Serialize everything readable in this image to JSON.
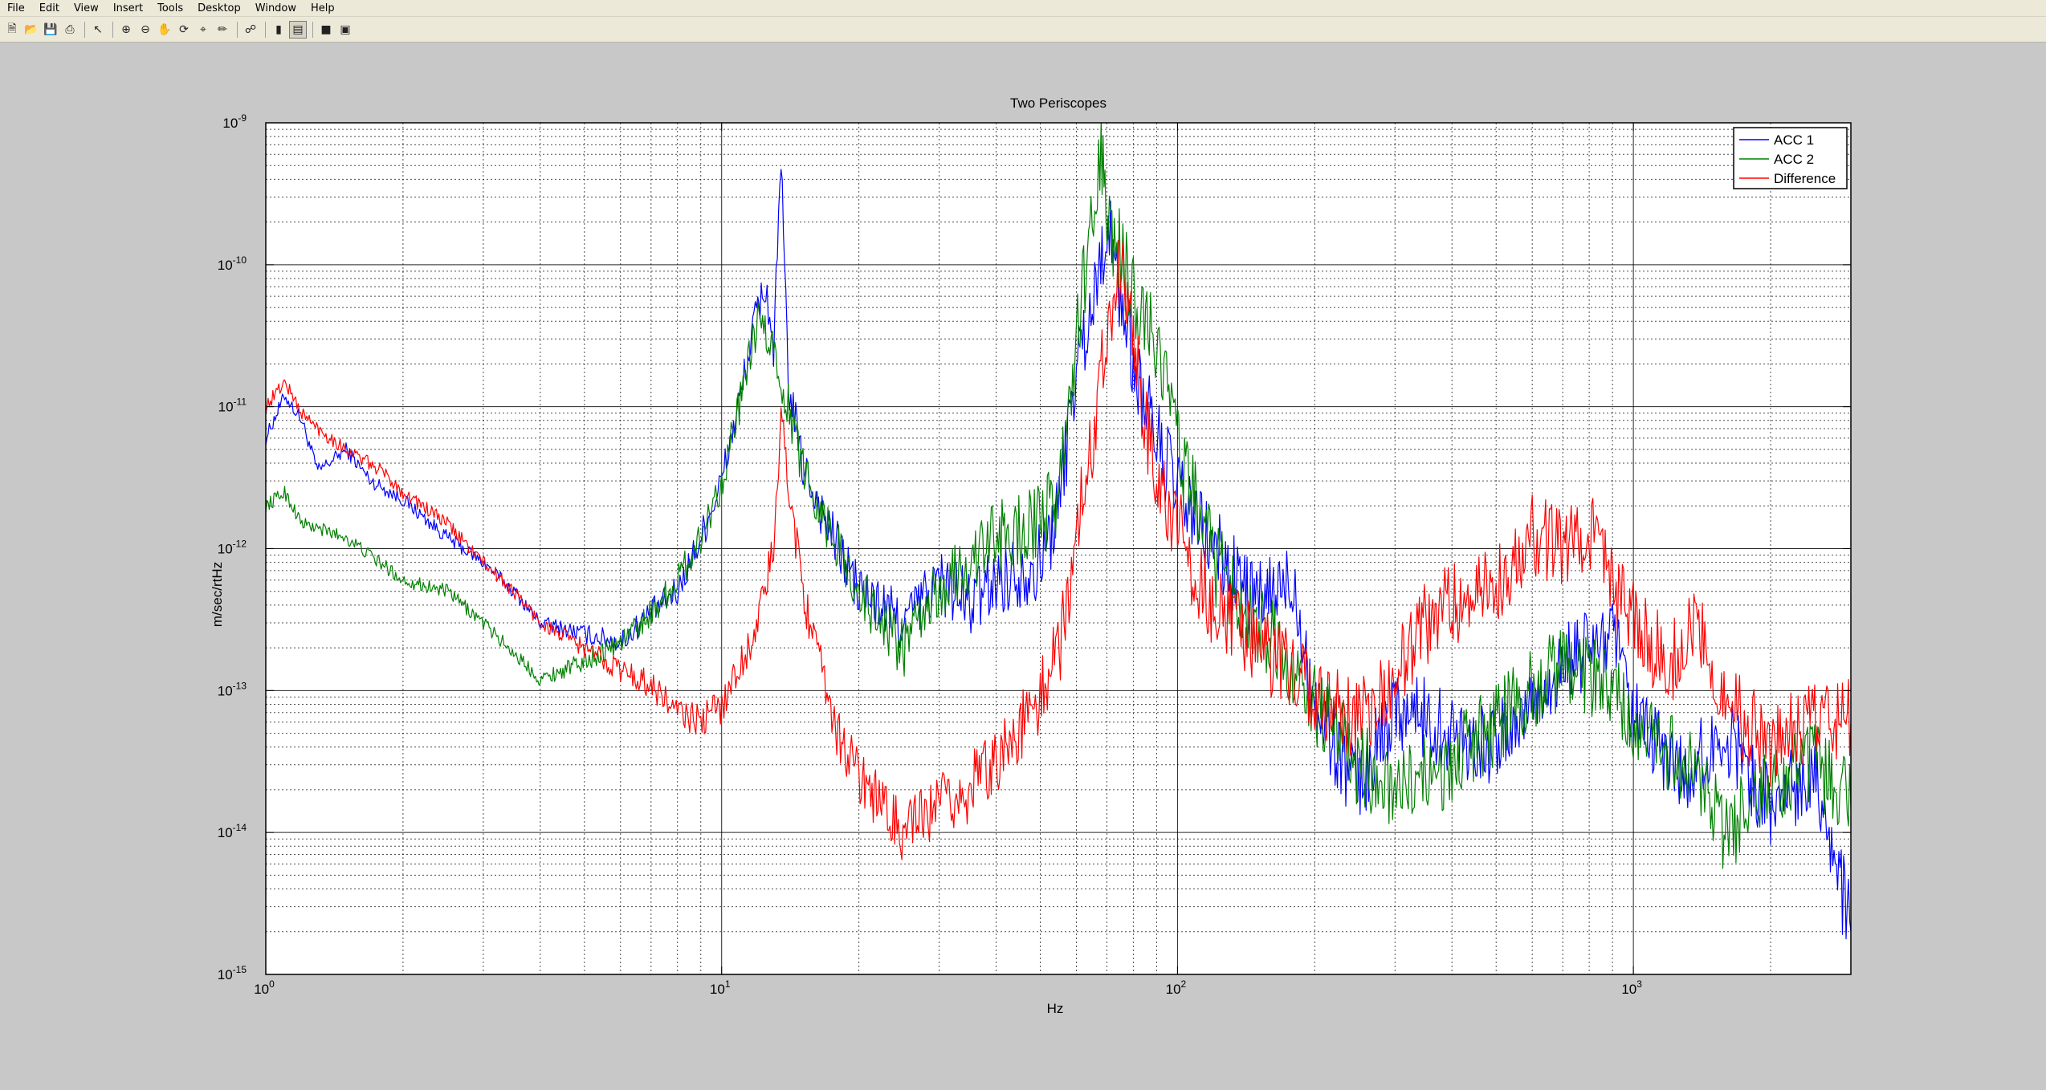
{
  "menu": [
    "File",
    "Edit",
    "View",
    "Insert",
    "Tools",
    "Desktop",
    "Window",
    "Help"
  ],
  "toolbar": {
    "icons": [
      "new-figure-icon",
      "open-file-icon",
      "save-icon",
      "print-icon",
      "edit-plot-icon",
      "zoom-in-icon",
      "zoom-out-icon",
      "pan-icon",
      "rotate-3d-icon",
      "data-cursor-icon",
      "brush-icon",
      "link-plot-icon",
      "insert-colorbar-icon",
      "insert-legend-icon",
      "hide-plot-tools-icon",
      "show-plot-tools-icon"
    ]
  },
  "chart_data": {
    "type": "line",
    "title": "Two Periscopes",
    "xlabel": "Hz",
    "ylabel": "m/sec/rtHz",
    "xscale": "log",
    "yscale": "log",
    "xlim": [
      1,
      3000
    ],
    "ylim": [
      1e-15,
      1e-09
    ],
    "grid": true,
    "legend_position": "top-right",
    "x_ticks": [
      {
        "value": 1,
        "base": "10",
        "exp": "0"
      },
      {
        "value": 10,
        "base": "10",
        "exp": "1"
      },
      {
        "value": 100,
        "base": "10",
        "exp": "2"
      },
      {
        "value": 1000,
        "base": "10",
        "exp": "3"
      }
    ],
    "y_ticks": [
      {
        "value": 1e-09,
        "base": "10",
        "exp": "-9"
      },
      {
        "value": 1e-10,
        "base": "10",
        "exp": "-10"
      },
      {
        "value": 1e-11,
        "base": "10",
        "exp": "-11"
      },
      {
        "value": 1e-12,
        "base": "10",
        "exp": "-12"
      },
      {
        "value": 1e-13,
        "base": "10",
        "exp": "-13"
      },
      {
        "value": 1e-14,
        "base": "10",
        "exp": "-14"
      },
      {
        "value": 1e-15,
        "base": "10",
        "exp": "-15"
      }
    ],
    "series": [
      {
        "name": "ACC 1",
        "color": "#0000ff",
        "points": [
          [
            1.0,
            6e-12
          ],
          [
            1.1,
            1.2e-11
          ],
          [
            1.2,
            8e-12
          ],
          [
            1.3,
            3.5e-12
          ],
          [
            1.5,
            5e-12
          ],
          [
            1.7,
            3e-12
          ],
          [
            2.0,
            2.2e-12
          ],
          [
            2.5,
            1.2e-12
          ],
          [
            3.0,
            8e-13
          ],
          [
            3.5,
            5e-13
          ],
          [
            4.0,
            3e-13
          ],
          [
            5.0,
            2.5e-13
          ],
          [
            6.0,
            2.2e-13
          ],
          [
            7.0,
            3.5e-13
          ],
          [
            8.0,
            5e-13
          ],
          [
            9.0,
            1.2e-12
          ],
          [
            10.0,
            3e-12
          ],
          [
            11.0,
            1.2e-11
          ],
          [
            12.0,
            5e-11
          ],
          [
            12.5,
            7e-11
          ],
          [
            13.0,
            2.5e-11
          ],
          [
            13.5,
            5e-10
          ],
          [
            14.0,
            1.5e-11
          ],
          [
            15.0,
            4e-12
          ],
          [
            17.0,
            1.5e-12
          ],
          [
            20.0,
            5e-13
          ],
          [
            25.0,
            3e-13
          ],
          [
            30.0,
            6e-13
          ],
          [
            35.0,
            4e-13
          ],
          [
            40.0,
            6e-13
          ],
          [
            50.0,
            8e-13
          ],
          [
            55.0,
            2e-12
          ],
          [
            60.0,
            2e-11
          ],
          [
            65.0,
            5e-11
          ],
          [
            70.0,
            2e-10
          ],
          [
            75.0,
            6e-11
          ],
          [
            80.0,
            2e-11
          ],
          [
            90.0,
            6e-12
          ],
          [
            100.0,
            2.5e-12
          ],
          [
            120.0,
            1e-12
          ],
          [
            150.0,
            4e-13
          ],
          [
            180.0,
            6e-13
          ],
          [
            200.0,
            8e-14
          ],
          [
            250.0,
            2e-14
          ],
          [
            300.0,
            8e-14
          ],
          [
            400.0,
            5e-14
          ],
          [
            500.0,
            4e-14
          ],
          [
            700.0,
            1.5e-13
          ],
          [
            900.0,
            2.5e-13
          ],
          [
            1000.0,
            6e-14
          ],
          [
            1300.0,
            2.5e-14
          ],
          [
            1600.0,
            5e-14
          ],
          [
            2000.0,
            1.5e-14
          ],
          [
            2500.0,
            3e-14
          ],
          [
            3000.0,
            2e-15
          ]
        ]
      },
      {
        "name": "ACC 2",
        "color": "#008000",
        "points": [
          [
            1.0,
            2e-12
          ],
          [
            1.1,
            2.5e-12
          ],
          [
            1.2,
            1.5e-12
          ],
          [
            1.5,
            1.2e-12
          ],
          [
            2.0,
            6e-13
          ],
          [
            2.5,
            5e-13
          ],
          [
            3.0,
            3e-13
          ],
          [
            4.0,
            1.2e-13
          ],
          [
            5.0,
            1.6e-13
          ],
          [
            6.0,
            2.2e-13
          ],
          [
            7.0,
            3.5e-13
          ],
          [
            8.0,
            6e-13
          ],
          [
            9.0,
            1.2e-12
          ],
          [
            10.0,
            3e-12
          ],
          [
            11.0,
            1.1e-11
          ],
          [
            12.0,
            4e-11
          ],
          [
            13.0,
            2.5e-11
          ],
          [
            14.0,
            1e-11
          ],
          [
            15.0,
            4e-12
          ],
          [
            17.0,
            1.5e-12
          ],
          [
            20.0,
            5e-13
          ],
          [
            25.0,
            2e-13
          ],
          [
            30.0,
            5e-13
          ],
          [
            40.0,
            1.2e-12
          ],
          [
            50.0,
            1.5e-12
          ],
          [
            55.0,
            2.5e-12
          ],
          [
            60.0,
            3e-11
          ],
          [
            65.0,
            2e-10
          ],
          [
            68.0,
            6e-10
          ],
          [
            70.0,
            2e-10
          ],
          [
            75.0,
            1.2e-10
          ],
          [
            80.0,
            6e-11
          ],
          [
            90.0,
            3e-11
          ],
          [
            100.0,
            6e-12
          ],
          [
            110.0,
            2e-12
          ],
          [
            120.0,
            8e-13
          ],
          [
            150.0,
            3e-13
          ],
          [
            200.0,
            8e-14
          ],
          [
            250.0,
            3e-14
          ],
          [
            300.0,
            2e-14
          ],
          [
            400.0,
            3e-14
          ],
          [
            500.0,
            6e-14
          ],
          [
            700.0,
            1.5e-13
          ],
          [
            900.0,
            1e-13
          ],
          [
            1000.0,
            5e-14
          ],
          [
            1300.0,
            3e-14
          ],
          [
            1600.0,
            1e-14
          ],
          [
            2000.0,
            2e-14
          ],
          [
            2500.0,
            3e-14
          ],
          [
            3000.0,
            1.5e-14
          ]
        ]
      },
      {
        "name": "Difference",
        "color": "#ff0000",
        "points": [
          [
            1.0,
            1e-11
          ],
          [
            1.1,
            1.5e-11
          ],
          [
            1.2,
            9e-12
          ],
          [
            1.3,
            7e-12
          ],
          [
            1.5,
            5e-12
          ],
          [
            1.8,
            3.5e-12
          ],
          [
            2.0,
            2.5e-12
          ],
          [
            2.5,
            1.5e-12
          ],
          [
            3.0,
            8e-13
          ],
          [
            3.5,
            5e-13
          ],
          [
            4.0,
            3e-13
          ],
          [
            5.0,
            2e-13
          ],
          [
            6.0,
            1.4e-13
          ],
          [
            7.0,
            1.1e-13
          ],
          [
            8.0,
            7e-14
          ],
          [
            9.0,
            6e-14
          ],
          [
            10.0,
            8e-14
          ],
          [
            11.0,
            1.5e-13
          ],
          [
            12.0,
            3e-13
          ],
          [
            13.0,
            1e-12
          ],
          [
            13.5,
            8e-12
          ],
          [
            14.0,
            3e-12
          ],
          [
            15.0,
            6e-13
          ],
          [
            16.0,
            2e-13
          ],
          [
            18.0,
            5e-14
          ],
          [
            20.0,
            2.5e-14
          ],
          [
            25.0,
            1e-14
          ],
          [
            30.0,
            1.5e-14
          ],
          [
            35.0,
            2e-14
          ],
          [
            40.0,
            3.5e-14
          ],
          [
            45.0,
            5e-14
          ],
          [
            50.0,
            9e-14
          ],
          [
            55.0,
            2e-13
          ],
          [
            60.0,
            1.2e-12
          ],
          [
            65.0,
            6e-12
          ],
          [
            70.0,
            4e-11
          ],
          [
            75.0,
            1e-10
          ],
          [
            80.0,
            3e-11
          ],
          [
            85.0,
            8e-12
          ],
          [
            90.0,
            3e-12
          ],
          [
            100.0,
            1.5e-12
          ],
          [
            110.0,
            6e-13
          ],
          [
            120.0,
            4e-13
          ],
          [
            150.0,
            2e-13
          ],
          [
            200.0,
            1e-13
          ],
          [
            250.0,
            6e-14
          ],
          [
            300.0,
            1.2e-13
          ],
          [
            350.0,
            3e-13
          ],
          [
            400.0,
            4e-13
          ],
          [
            450.0,
            5e-13
          ],
          [
            500.0,
            6e-13
          ],
          [
            600.0,
            1.2e-12
          ],
          [
            700.0,
            1e-12
          ],
          [
            800.0,
            1.5e-12
          ],
          [
            900.0,
            5e-13
          ],
          [
            1000.0,
            3e-13
          ],
          [
            1200.0,
            1.5e-13
          ],
          [
            1400.0,
            3e-13
          ],
          [
            1600.0,
            8e-14
          ],
          [
            2000.0,
            4e-14
          ],
          [
            2500.0,
            6e-14
          ],
          [
            3000.0,
            6e-14
          ]
        ]
      }
    ]
  }
}
